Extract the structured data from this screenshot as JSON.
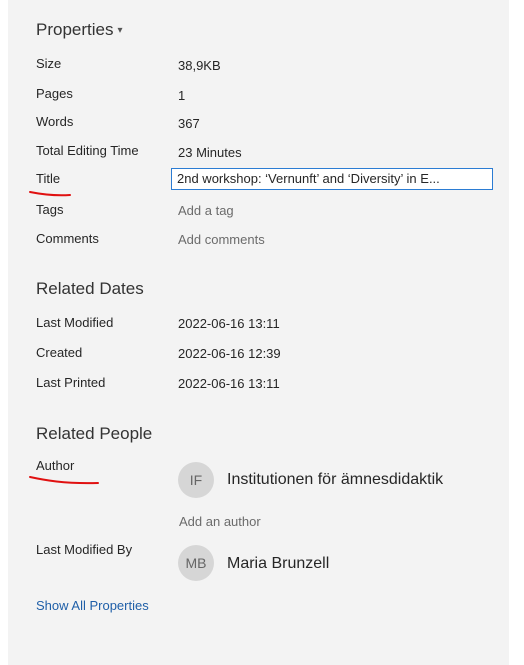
{
  "properties": {
    "title": "Properties",
    "rows": [
      {
        "label": "Size",
        "value": "38,9KB"
      },
      {
        "label": "Pages",
        "value": "1"
      },
      {
        "label": "Words",
        "value": "367"
      },
      {
        "label": "Total Editing Time",
        "value": "23 Minutes"
      }
    ],
    "title_label": "Title",
    "title_value": "2nd workshop: ‘Vernunft’ and ‘Diversity’ in E...",
    "tags_label": "Tags",
    "tags_placeholder": "Add a tag",
    "comments_label": "Comments",
    "comments_placeholder": "Add comments"
  },
  "related_dates": {
    "title": "Related Dates",
    "rows": [
      {
        "label": "Last Modified",
        "value": "2022-06-16 13:11"
      },
      {
        "label": "Created",
        "value": "2022-06-16 12:39"
      },
      {
        "label": "Last Printed",
        "value": "2022-06-16 13:11"
      }
    ]
  },
  "related_people": {
    "title": "Related People",
    "author_label": "Author",
    "author_initials": "IF",
    "author_name": "Institutionen för ämnesdidaktik",
    "add_author": "Add an author",
    "last_modified_by_label": "Last Modified By",
    "modifier_initials": "MB",
    "modifier_name": "Maria Brunzell"
  },
  "show_all_properties": "Show All Properties",
  "colors": {
    "panel_bg": "#f3f3f3",
    "link": "#1f5fa8",
    "annotation_red": "#e01010",
    "input_border": "#2b7cd3"
  }
}
